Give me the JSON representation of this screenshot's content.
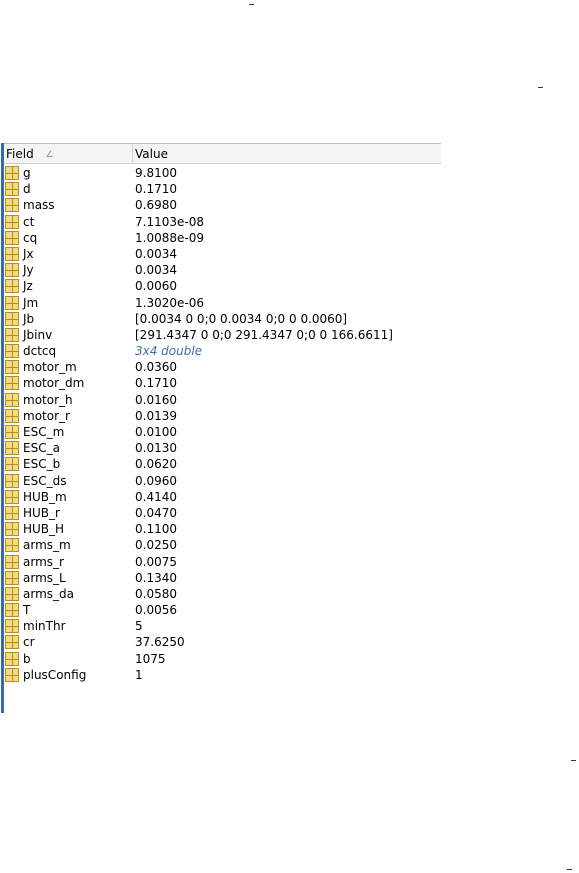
{
  "table": {
    "header": {
      "field": "Field",
      "value": "Value",
      "sort_icon": "sort-ascending-icon"
    },
    "rows": [
      {
        "field": "g",
        "value": "9.8100"
      },
      {
        "field": "d",
        "value": "0.1710"
      },
      {
        "field": "mass",
        "value": "0.6980"
      },
      {
        "field": "ct",
        "value": "7.1103e-08"
      },
      {
        "field": "cq",
        "value": "1.0088e-09"
      },
      {
        "field": "Jx",
        "value": "0.0034"
      },
      {
        "field": "Jy",
        "value": "0.0034"
      },
      {
        "field": "Jz",
        "value": "0.0060"
      },
      {
        "field": "Jm",
        "value": "1.3020e-06"
      },
      {
        "field": "Jb",
        "value": "[0.0034 0 0;0 0.0034 0;0 0 0.0060]"
      },
      {
        "field": "Jbinv",
        "value": "[291.4347 0 0;0 291.4347 0;0 0 166.6611]"
      },
      {
        "field": "dctcq",
        "value": "3x4 double"
      },
      {
        "field": "motor_m",
        "value": "0.0360"
      },
      {
        "field": "motor_dm",
        "value": "0.1710"
      },
      {
        "field": "motor_h",
        "value": "0.0160"
      },
      {
        "field": "motor_r",
        "value": "0.0139"
      },
      {
        "field": "ESC_m",
        "value": "0.0100"
      },
      {
        "field": "ESC_a",
        "value": "0.0130"
      },
      {
        "field": "ESC_b",
        "value": "0.0620"
      },
      {
        "field": "ESC_ds",
        "value": "0.0960"
      },
      {
        "field": "HUB_m",
        "value": "0.4140"
      },
      {
        "field": "HUB_r",
        "value": "0.0470"
      },
      {
        "field": "HUB_H",
        "value": "0.1100"
      },
      {
        "field": "arms_m",
        "value": "0.0250"
      },
      {
        "field": "arms_r",
        "value": "0.0075"
      },
      {
        "field": "arms_L",
        "value": "0.1340"
      },
      {
        "field": "arms_da",
        "value": "0.0580"
      },
      {
        "field": "T",
        "value": "0.0056"
      },
      {
        "field": "minThr",
        "value": "5"
      },
      {
        "field": "cr",
        "value": "37.6250"
      },
      {
        "field": "b",
        "value": "1075"
      },
      {
        "field": "plusConfig",
        "value": "1"
      }
    ]
  },
  "icon_names": {
    "field_icon": "struct-field-grid-icon"
  },
  "colors": {
    "accent_border": "#3a6aa6",
    "link_value": "#3d6fa8",
    "icon_fill": "#f5dc7a"
  }
}
